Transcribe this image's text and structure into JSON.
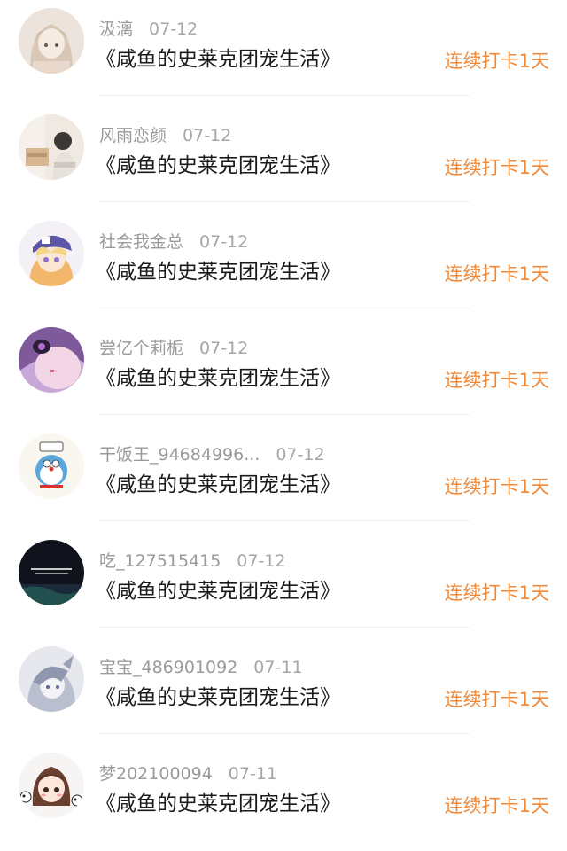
{
  "entries": [
    {
      "name": "汲漓",
      "date": "07-12",
      "title": "《咸鱼的史莱克团宠生活》",
      "badge": "连续打卡1天",
      "avatar": "anime-girl-light-hair"
    },
    {
      "name": "风雨恋颜",
      "date": "07-12",
      "title": "《咸鱼的史莱克团宠生活》",
      "badge": "连续打卡1天",
      "avatar": "room-photo"
    },
    {
      "name": "社会我金总",
      "date": "07-12",
      "title": "《咸鱼的史莱克团宠生活》",
      "badge": "连续打卡1天",
      "avatar": "anime-boy-cap"
    },
    {
      "name": "尝亿个莉栀",
      "date": "07-12",
      "title": "《咸鱼的史莱克团宠生活》",
      "badge": "连续打卡1天",
      "avatar": "anime-purple"
    },
    {
      "name": "干饭王_94684996...",
      "date": "07-12",
      "title": "《咸鱼的史莱克团宠生活》",
      "badge": "连续打卡1天",
      "avatar": "doraemon"
    },
    {
      "name": "吃_127515415",
      "date": "07-12",
      "title": "《咸鱼的史莱克团宠生活》",
      "badge": "连续打卡1天",
      "avatar": "dark-text"
    },
    {
      "name": "宝宝_486901092",
      "date": "07-11",
      "title": "《咸鱼的史莱克团宠生活》",
      "badge": "连续打卡1天",
      "avatar": "anime-grey"
    },
    {
      "name": "梦202100094",
      "date": "07-11",
      "title": "《咸鱼的史莱克团宠生活》",
      "badge": "连续打卡1天",
      "avatar": "chibi-girl-pandas"
    }
  ],
  "colors": {
    "badge": "#ef8a3a",
    "name": "#9a9a9a",
    "title": "#1a1a1a"
  }
}
